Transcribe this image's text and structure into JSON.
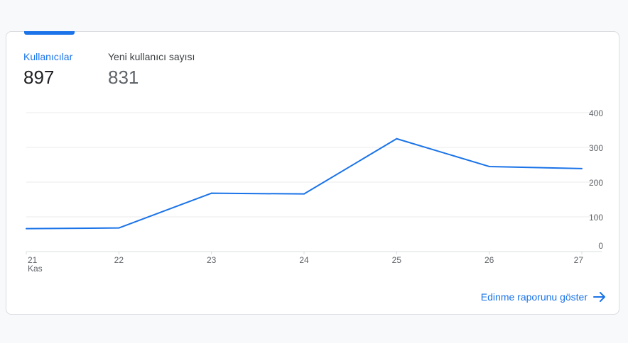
{
  "metrics": {
    "users": {
      "label": "Kullanıcılar",
      "value": "897"
    },
    "new_users": {
      "label": "Yeni kullanıcı sayısı",
      "value": "831"
    }
  },
  "chart_data": {
    "type": "line",
    "x": [
      "21",
      "22",
      "23",
      "24",
      "25",
      "26",
      "27"
    ],
    "x_sublabel_first": "Kas",
    "series": [
      {
        "values": [
          66,
          68,
          168,
          166,
          325,
          245,
          239
        ]
      }
    ],
    "ylim": [
      0,
      400
    ],
    "yticks": [
      0,
      100,
      200,
      300,
      400
    ],
    "y_axis_side": "right",
    "grid": true,
    "color": "#1a73e8"
  },
  "link": {
    "label": "Edinme raporunu göster",
    "icon": "arrow-right-icon"
  }
}
